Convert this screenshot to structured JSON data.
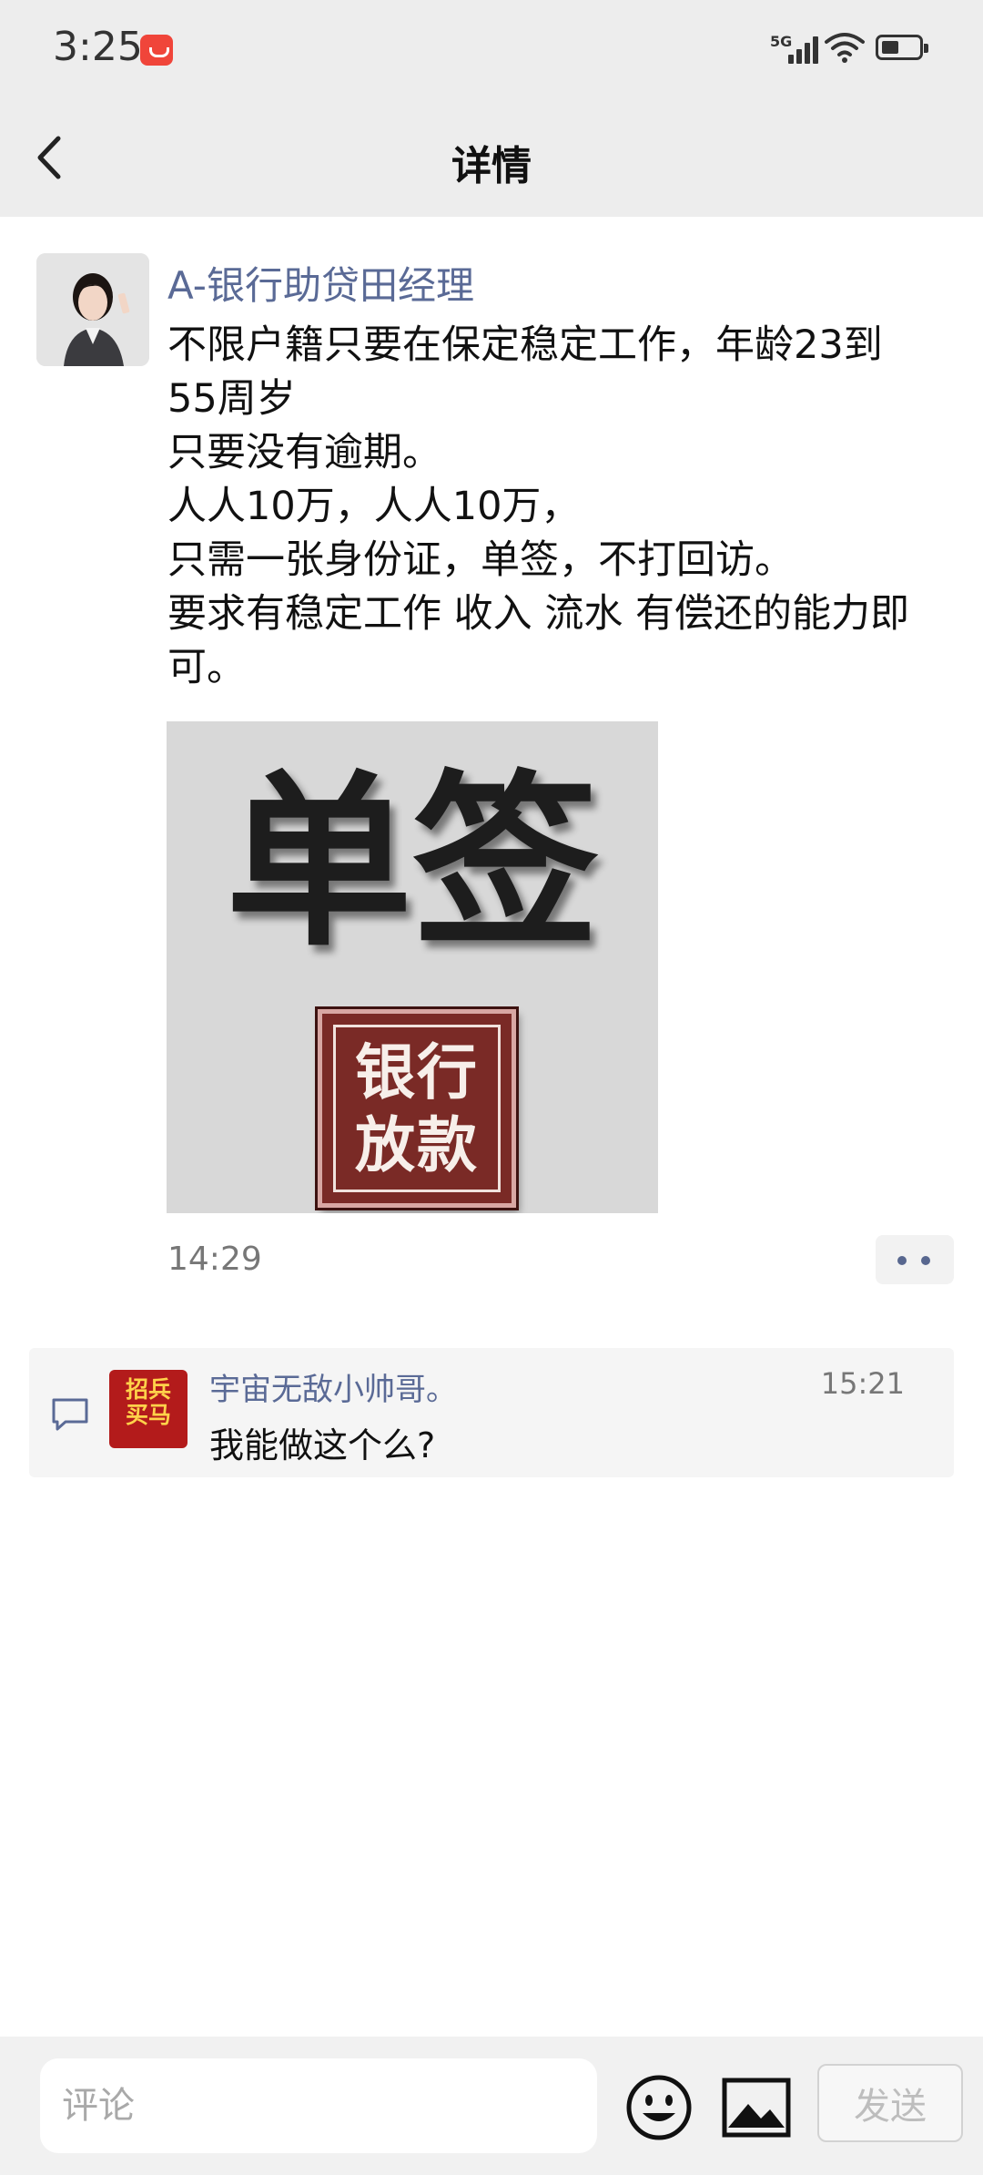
{
  "status_bar": {
    "time": "3:25",
    "network": "5G"
  },
  "header": {
    "title": "详情"
  },
  "post": {
    "author": "A-银行助贷田经理",
    "lines": [
      "不限户籍只要在保定稳定工作，年龄23到",
      "55周岁",
      "只要没有逾期。",
      "人人10万，人人10万，",
      "只需一张身份证，单签，不打回访。",
      "要求有稳定工作 收入 流水 有偿还的能力即",
      "可。"
    ],
    "image": {
      "big_text": "单签",
      "seal_line1": "银行",
      "seal_line2": "放款"
    },
    "time": "14:29"
  },
  "comments": [
    {
      "avatar_text_line1": "招兵",
      "avatar_text_line2": "买马",
      "name": "宇宙无敌小帅哥。",
      "time": "15:21",
      "text": "我能做这个么?"
    }
  ],
  "input_bar": {
    "placeholder": "评论",
    "send_label": "发送"
  },
  "icons": {
    "back": "chevron-left-icon",
    "more": "more-dots-icon",
    "comment": "comment-bubble-icon",
    "emoji": "smiley-icon",
    "image": "image-icon"
  },
  "colors": {
    "name_blue": "#5a6a96",
    "header_bg": "#ededed",
    "seal_red": "#7a2a26"
  }
}
